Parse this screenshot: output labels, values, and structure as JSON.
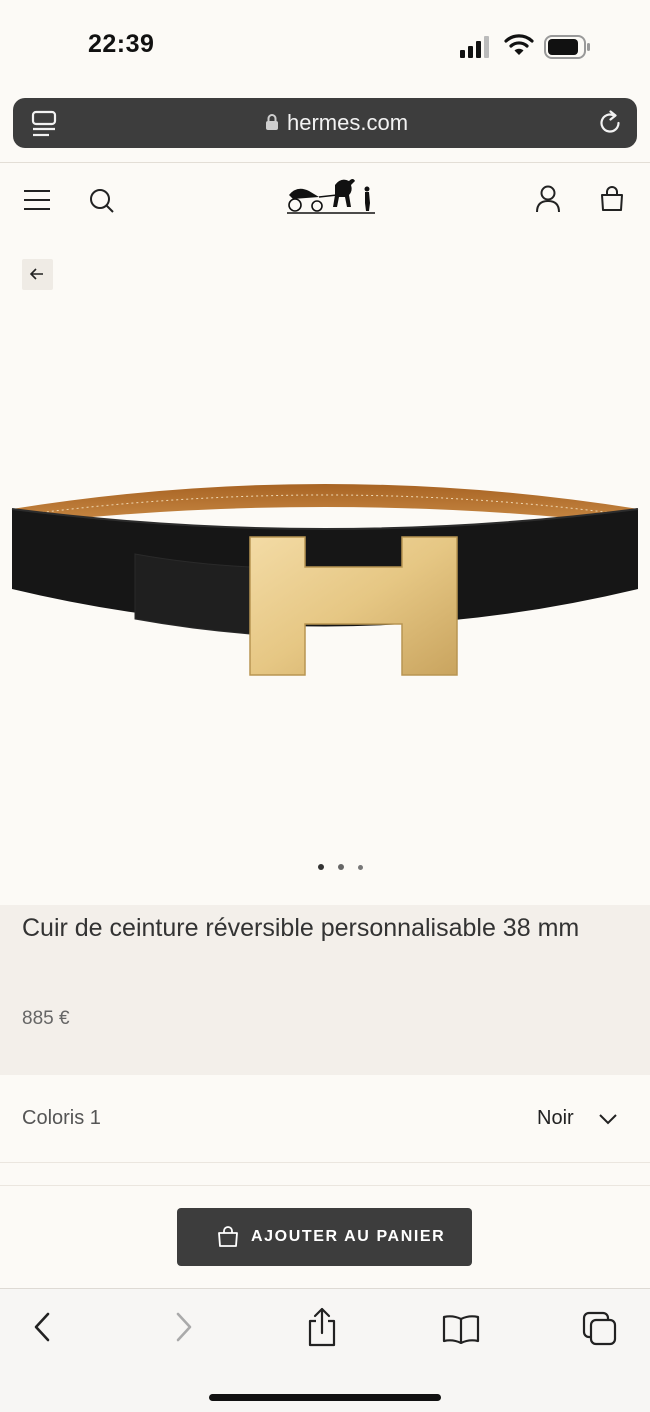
{
  "status_bar": {
    "time": "22:39"
  },
  "browser": {
    "url": "hermes.com"
  },
  "site_header": {
    "icons": [
      "menu-icon",
      "search-icon",
      "hermes-carriage-logo",
      "account-icon",
      "shopping-bag-icon"
    ]
  },
  "gallery": {
    "back_icon": "arrow-left-icon",
    "image": "reversible-belt-black-gold-h-buckle",
    "page_count": 3,
    "active_page": 1
  },
  "product": {
    "title": "Cuir de ceinture réversible personnalisable 38 mm",
    "price": "885 €"
  },
  "options": {
    "color_label": "Coloris 1",
    "color_value": "Noir"
  },
  "cta": {
    "add_to_cart": "AJOUTER AU PANIER"
  },
  "toolbar": {
    "icons": [
      "back-icon",
      "forward-icon",
      "share-icon",
      "bookmarks-icon",
      "tabs-icon"
    ]
  },
  "colors": {
    "cta_bg": "#3d3d3d",
    "info_bg": "#f3efea",
    "page_bg": "#fcfaf6"
  }
}
